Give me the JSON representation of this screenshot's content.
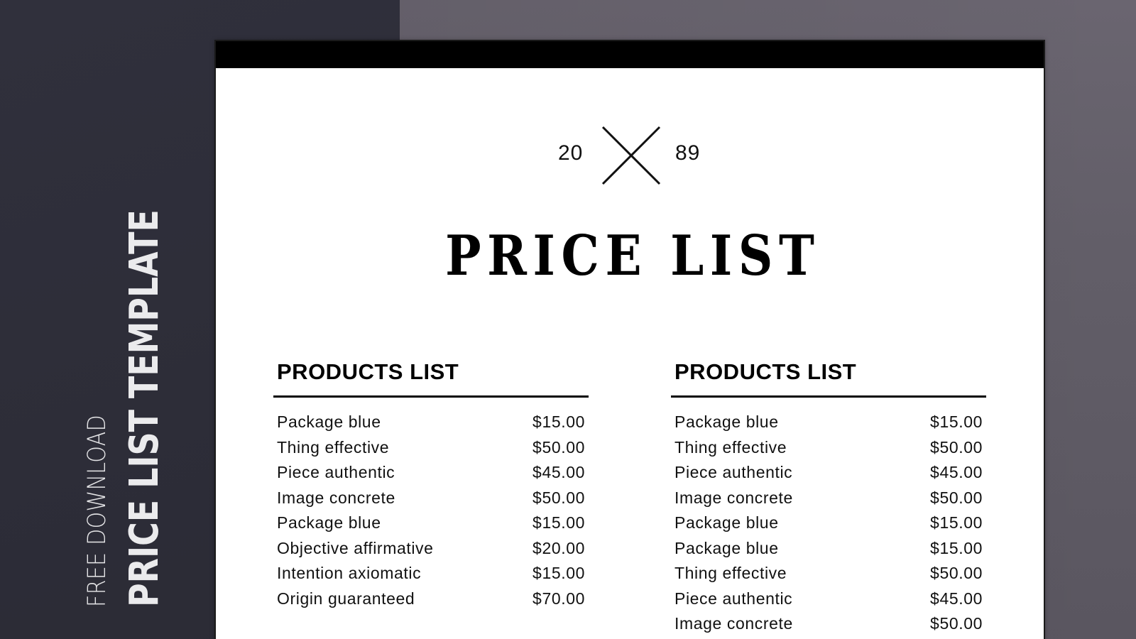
{
  "sidebar": {
    "subtitle": "FREE DOWNLOAD",
    "title": "PRICE LIST TEMPLATE"
  },
  "colors": {
    "left_panel": "#2f2f3b",
    "right_panel": "#625e68",
    "card": "#ffffff",
    "card_bar": "#000000",
    "text": "#000000",
    "sidebar_text": "#e8e8ea"
  },
  "document": {
    "year_left": "20",
    "year_right": "89",
    "divider_icon": "x-mark-icon",
    "title": "PRICE LIST",
    "columns": [
      {
        "heading": "PRODUCTS LIST",
        "items": [
          {
            "name": "Package blue",
            "price": "$15.00"
          },
          {
            "name": "Thing effective",
            "price": "$50.00"
          },
          {
            "name": "Piece authentic",
            "price": "$45.00"
          },
          {
            "name": "Image concrete",
            "price": "$50.00"
          },
          {
            "name": "Package blue",
            "price": "$15.00"
          },
          {
            "name": "Objective affirmative",
            "price": "$20.00"
          },
          {
            "name": "Intention axiomatic",
            "price": "$15.00"
          },
          {
            "name": "Origin guaranteed",
            "price": "$70.00"
          }
        ]
      },
      {
        "heading": "PRODUCTS LIST",
        "items": [
          {
            "name": "Package blue",
            "price": "$15.00"
          },
          {
            "name": "Thing effective",
            "price": "$50.00"
          },
          {
            "name": "Piece authentic",
            "price": "$45.00"
          },
          {
            "name": "Image concrete",
            "price": "$50.00"
          },
          {
            "name": "Package blue",
            "price": "$15.00"
          },
          {
            "name": "Package blue",
            "price": "$15.00"
          },
          {
            "name": "Thing effective",
            "price": "$50.00"
          },
          {
            "name": "Piece authentic",
            "price": "$45.00"
          },
          {
            "name": "Image concrete",
            "price": "$50.00"
          }
        ]
      }
    ]
  }
}
